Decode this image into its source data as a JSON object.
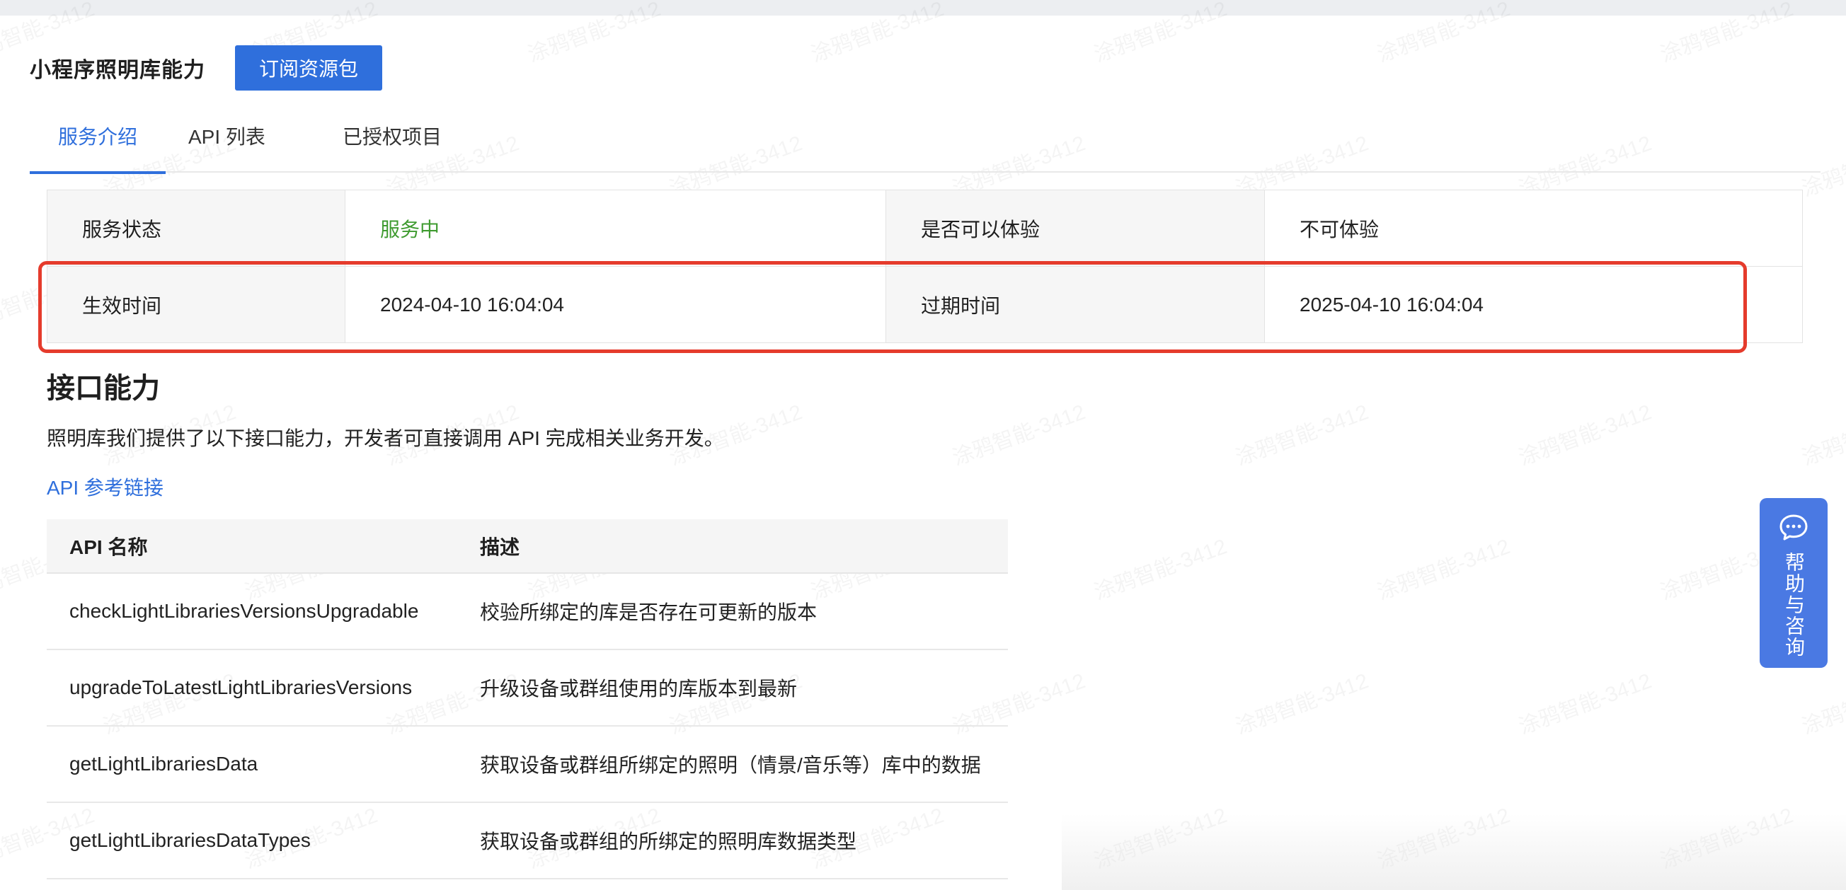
{
  "header": {
    "title": "小程序照明库能力",
    "subscribe_button": "订阅资源包"
  },
  "tabs": [
    {
      "label": "服务介绍",
      "active": true
    },
    {
      "label": "API 列表",
      "active": false
    },
    {
      "label": "已授权项目",
      "active": false
    }
  ],
  "service_info": {
    "status_label": "服务状态",
    "status_value": "服务中",
    "trial_label": "是否可以体验",
    "trial_value": "不可体验",
    "effective_label": "生效时间",
    "effective_value": "2024-04-10 16:04:04",
    "expire_label": "过期时间",
    "expire_value": "2025-04-10 16:04:04"
  },
  "api_section": {
    "title": "接口能力",
    "description": "照明库我们提供了以下接口能力，开发者可直接调用 API 完成相关业务开发。",
    "reference_link": "API 参考链接",
    "columns": [
      "API 名称",
      "描述"
    ],
    "rows": [
      {
        "name": "checkLightLibrariesVersionsUpgradable",
        "desc": "校验所绑定的库是否存在可更新的版本"
      },
      {
        "name": "upgradeToLatestLightLibrariesVersions",
        "desc": "升级设备或群组使用的库版本到最新"
      },
      {
        "name": "getLightLibrariesData",
        "desc": "获取设备或群组所绑定的照明（情景/音乐等）库中的数据"
      },
      {
        "name": "getLightLibrariesDataTypes",
        "desc": "获取设备或群组的所绑定的照明库数据类型"
      }
    ]
  },
  "help_float": {
    "label": "帮助与咨询",
    "icon": "chat-icon"
  },
  "watermark": "涂鸦智能-3412",
  "colors": {
    "primary": "#2f6fdc",
    "status_green": "#3f9b30",
    "highlight_red": "#e53b2c",
    "help_bg": "#4a79e3"
  }
}
